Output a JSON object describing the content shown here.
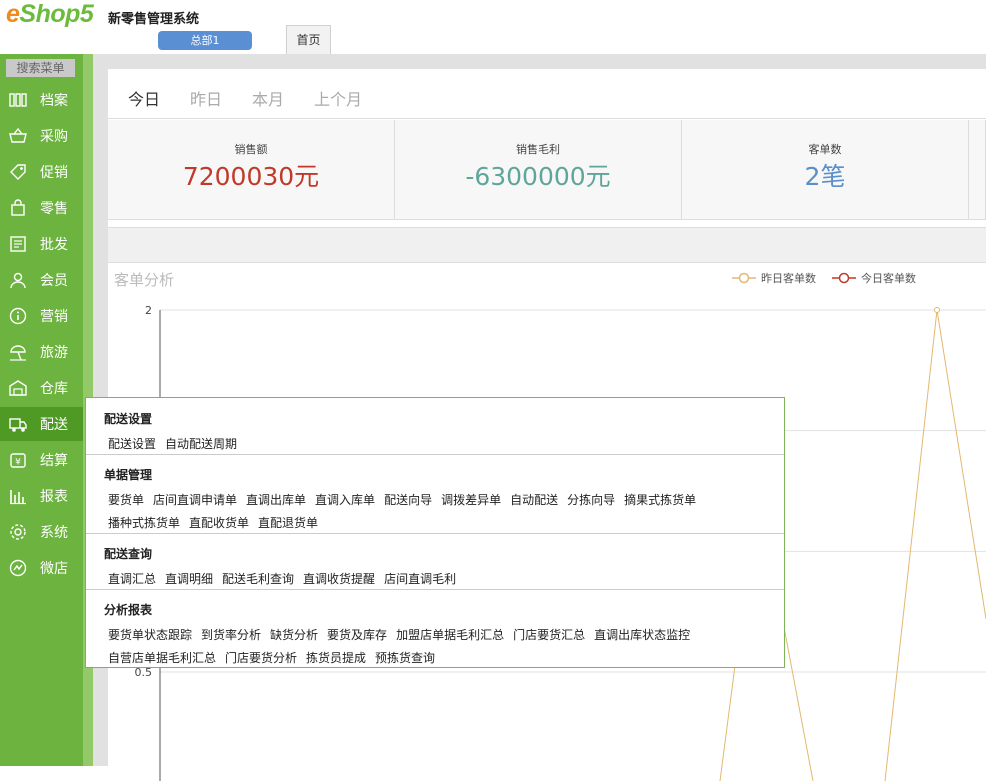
{
  "app": {
    "logo_e": "e",
    "logo_rest": "Shop5",
    "title": "新零售管理系统",
    "branch": "总部1",
    "home_tab": "首页"
  },
  "sidebar": {
    "search_label": "搜索菜单",
    "items": [
      {
        "label": "档案",
        "icon": "archive-icon"
      },
      {
        "label": "采购",
        "icon": "basket-icon"
      },
      {
        "label": "促销",
        "icon": "tag-icon"
      },
      {
        "label": "零售",
        "icon": "shopping-bag-icon"
      },
      {
        "label": "批发",
        "icon": "receipt-icon"
      },
      {
        "label": "会员",
        "icon": "user-icon"
      },
      {
        "label": "营销",
        "icon": "info-icon"
      },
      {
        "label": "旅游",
        "icon": "beach-umbrella-icon"
      },
      {
        "label": "仓库",
        "icon": "warehouse-icon"
      },
      {
        "label": "配送",
        "icon": "truck-icon"
      },
      {
        "label": "结算",
        "icon": "settlement-icon"
      },
      {
        "label": "报表",
        "icon": "bar-chart-icon"
      },
      {
        "label": "系统",
        "icon": "gear-icon"
      },
      {
        "label": "微店",
        "icon": "micro-shop-icon"
      }
    ]
  },
  "dashboard": {
    "periods": [
      "今日",
      "昨日",
      "本月",
      "上个月"
    ],
    "stats": [
      {
        "title": "销售额",
        "value": "7200030元",
        "color": "#c0392b"
      },
      {
        "title": "销售毛利",
        "value": "-6300000元",
        "color": "#5fa69a"
      },
      {
        "title": "客单数",
        "value": "2笔",
        "color": "#5b8fc9"
      }
    ],
    "chart_title": "客单分析"
  },
  "chart_data": {
    "type": "line",
    "title": "客单分析",
    "series": [
      {
        "name": "昨日客单数",
        "color": "#e3b870"
      },
      {
        "name": "今日客单数",
        "color": "#c0392b"
      }
    ],
    "y_ticks": [
      "2",
      "0.5"
    ],
    "ylim": [
      0,
      2
    ],
    "grid": true,
    "legend": "top-right",
    "peak_value": 2
  },
  "flyout": {
    "sections": [
      {
        "title": "配送设置",
        "rows": [
          [
            "配送设置",
            "自动配送周期"
          ]
        ]
      },
      {
        "title": "单据管理",
        "rows": [
          [
            "要货单",
            "店间直调申请单",
            "直调出库单",
            "直调入库单",
            "配送向导",
            "调拨差异单",
            "自动配送",
            "分拣向导",
            "摘果式拣货单"
          ],
          [
            "播种式拣货单",
            "直配收货单",
            "直配退货单"
          ]
        ]
      },
      {
        "title": "配送查询",
        "rows": [
          [
            "直调汇总",
            "直调明细",
            "配送毛利查询",
            "直调收货提醒",
            "店间直调毛利"
          ]
        ]
      },
      {
        "title": "分析报表",
        "rows": [
          [
            "要货单状态跟踪",
            "到货率分析",
            "缺货分析",
            "要货及库存",
            "加盟店单据毛利汇总",
            "门店要货汇总",
            "直调出库状态监控"
          ],
          [
            "自营店单据毛利汇总",
            "门店要货分析",
            "拣货员提成",
            "预拣货查询"
          ]
        ]
      }
    ]
  }
}
